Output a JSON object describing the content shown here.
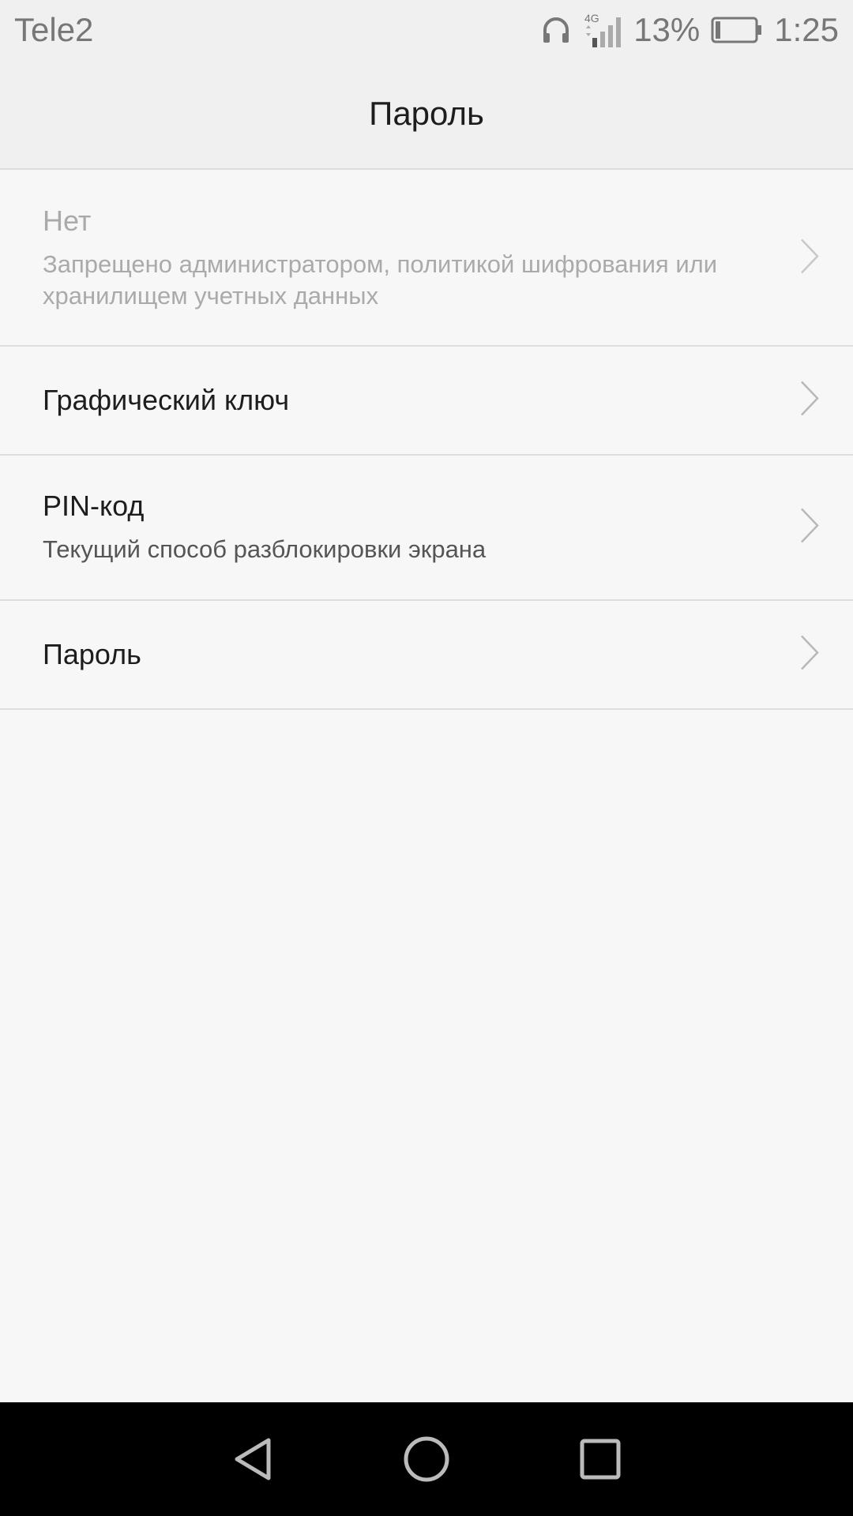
{
  "status_bar": {
    "carrier": "Tele2",
    "network": "4G",
    "battery_percent": "13%",
    "battery_level": 0.13,
    "time": "1:25"
  },
  "header": {
    "title": "Пароль"
  },
  "options": [
    {
      "title": "Нет",
      "subtitle": "Запрещено администратором, политикой шифрования или хранилищем учетных данных",
      "disabled": true
    },
    {
      "title": "Графический ключ"
    },
    {
      "title": "PIN-код",
      "subtitle": "Текущий способ разблокировки экрана"
    },
    {
      "title": "Пароль"
    }
  ],
  "icons": {
    "chevron": "chevron-right-icon",
    "headphones": "headphones-icon",
    "signal": "signal-icon",
    "battery": "battery-icon",
    "back": "back-icon",
    "home": "home-icon",
    "recents": "recents-icon"
  },
  "colors": {
    "background": "#f7f7f7",
    "header_bg": "#f0f0f0",
    "nav_bg": "#000000",
    "disabled_text": "#aaaaaa",
    "primary_text": "#1d1d1d"
  }
}
